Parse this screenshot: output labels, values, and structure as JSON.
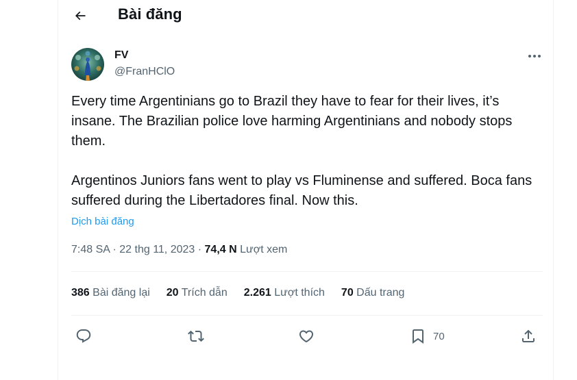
{
  "header": {
    "title": "Bài đăng"
  },
  "author": {
    "name": "FV",
    "handle": "@FranHClO"
  },
  "tweet": {
    "paragraphs": [
      "Every time Argentinians go to Brazil they have to fear for their lives, it’s insane. The Brazilian police love harming Argentinians and nobody stops them.",
      "Argentinos Juniors fans went to play vs Fluminense and suffered. Boca fans suffered during the Libertadores final. Now this."
    ],
    "translate_label": "Dịch bài đăng"
  },
  "meta": {
    "time": "7:48 SA",
    "separator": " · ",
    "date": "22 thg 11, 2023",
    "views_count": "74,4 N",
    "views_label": "Lượt xem"
  },
  "stats": [
    {
      "count": "386",
      "label": "Bài đăng lại"
    },
    {
      "count": "20",
      "label": "Trích dẫn"
    },
    {
      "count": "2.261",
      "label": "Lượt thích"
    },
    {
      "count": "70",
      "label": "Dấu trang"
    }
  ],
  "actions": {
    "reply_icon": "reply-icon",
    "retweet_icon": "retweet-icon",
    "like_icon": "heart-icon",
    "bookmark_icon": "bookmark-icon",
    "bookmark_count": "70",
    "share_icon": "share-icon"
  },
  "colors": {
    "text": "#0f1419",
    "secondary": "#536471",
    "link": "#1d9bf0",
    "border": "#eff3f4"
  }
}
